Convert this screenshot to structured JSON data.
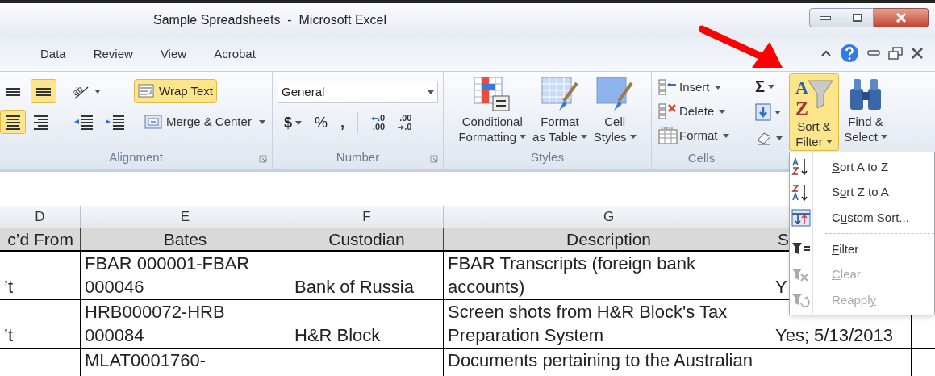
{
  "window": {
    "title": "Sample Spreadsheets  -  Microsoft Excel"
  },
  "tabs": [
    {
      "label": "Data",
      "selected": false
    },
    {
      "label": "Review",
      "selected": false
    },
    {
      "label": "View",
      "selected": false
    },
    {
      "label": "Acrobat",
      "selected": false
    }
  ],
  "alignment": {
    "label": "Alignment",
    "row1": [
      {
        "kind": "middle",
        "on": false
      },
      {
        "kind": "bottom",
        "on": true
      },
      {
        "kind": "orientation",
        "on": false,
        "glyph": "ab"
      }
    ],
    "row2": [
      {
        "kind": "center",
        "on": true
      },
      {
        "kind": "right",
        "on": false
      },
      {
        "kind": "outdent",
        "on": false
      },
      {
        "kind": "indent",
        "on": false
      }
    ],
    "wrap_text": {
      "label": "Wrap Text",
      "on": true
    },
    "merge": {
      "label": "Merge & Center"
    }
  },
  "number": {
    "label": "Number",
    "format": "General",
    "currency": "$",
    "percent": "%",
    "comma": ",",
    "increase": {
      "top": ".0",
      "bottom": ".00"
    },
    "decrease": {
      "top": ".00",
      "bottom": ".0"
    }
  },
  "styles": {
    "label": "Styles",
    "buttons": [
      {
        "kind": "conditional",
        "lines": [
          "Conditional",
          "Formatting"
        ]
      },
      {
        "kind": "table",
        "lines": [
          "Format",
          "as Table"
        ]
      },
      {
        "kind": "cellstyles",
        "lines": [
          "Cell",
          "Styles"
        ]
      }
    ]
  },
  "cells": {
    "label": "Cells",
    "buttons": [
      {
        "kind": "insert",
        "label": "Insert"
      },
      {
        "kind": "delete",
        "label": "Delete"
      },
      {
        "kind": "format",
        "label": "Format"
      }
    ]
  },
  "editing": {
    "sum": "Σ",
    "buttons": [
      {
        "kind": "sort",
        "letters": [
          "A",
          "Z"
        ],
        "lines": [
          "Sort &",
          "Filter"
        ],
        "on": true
      },
      {
        "kind": "find",
        "lines": [
          "Find &",
          "Select"
        ],
        "on": false
      }
    ]
  },
  "sheet": {
    "columns": [
      "D",
      "E",
      "F",
      "G"
    ],
    "header": [
      "c’d From",
      "Bates",
      "Custodian",
      "Description",
      "S"
    ],
    "rows": [
      [
        "’t",
        "FBAR 000001-FBAR 000046",
        "Bank of Russia",
        "FBAR Transcripts (foreign bank accounts)",
        "Y"
      ],
      [
        "’t",
        "HRB000072-HRB 000084",
        "H&R Block",
        "Screen shots from H&R Block's Tax Preparation System",
        "Yes; 5/13/2013"
      ],
      [
        "",
        "MLAT0001760-",
        "",
        "Documents pertaining to the Australian",
        ""
      ]
    ]
  },
  "menu": [
    {
      "kind": "az",
      "key": "S",
      "after": "ort A to Z",
      "disabled": false
    },
    {
      "kind": "za",
      "before": "S",
      "key": "o",
      "after": "rt Z to A",
      "disabled": false
    },
    {
      "kind": "custom",
      "before": "C",
      "key": "u",
      "after": "stom Sort...",
      "disabled": false
    },
    {
      "kind": "separator"
    },
    {
      "kind": "filter",
      "key": "F",
      "after": "ilter",
      "disabled": false
    },
    {
      "kind": "clear",
      "key": "C",
      "after": "lear",
      "disabled": true
    },
    {
      "kind": "reapply",
      "before": "Reappl",
      "key": "y",
      "disabled": true
    }
  ]
}
